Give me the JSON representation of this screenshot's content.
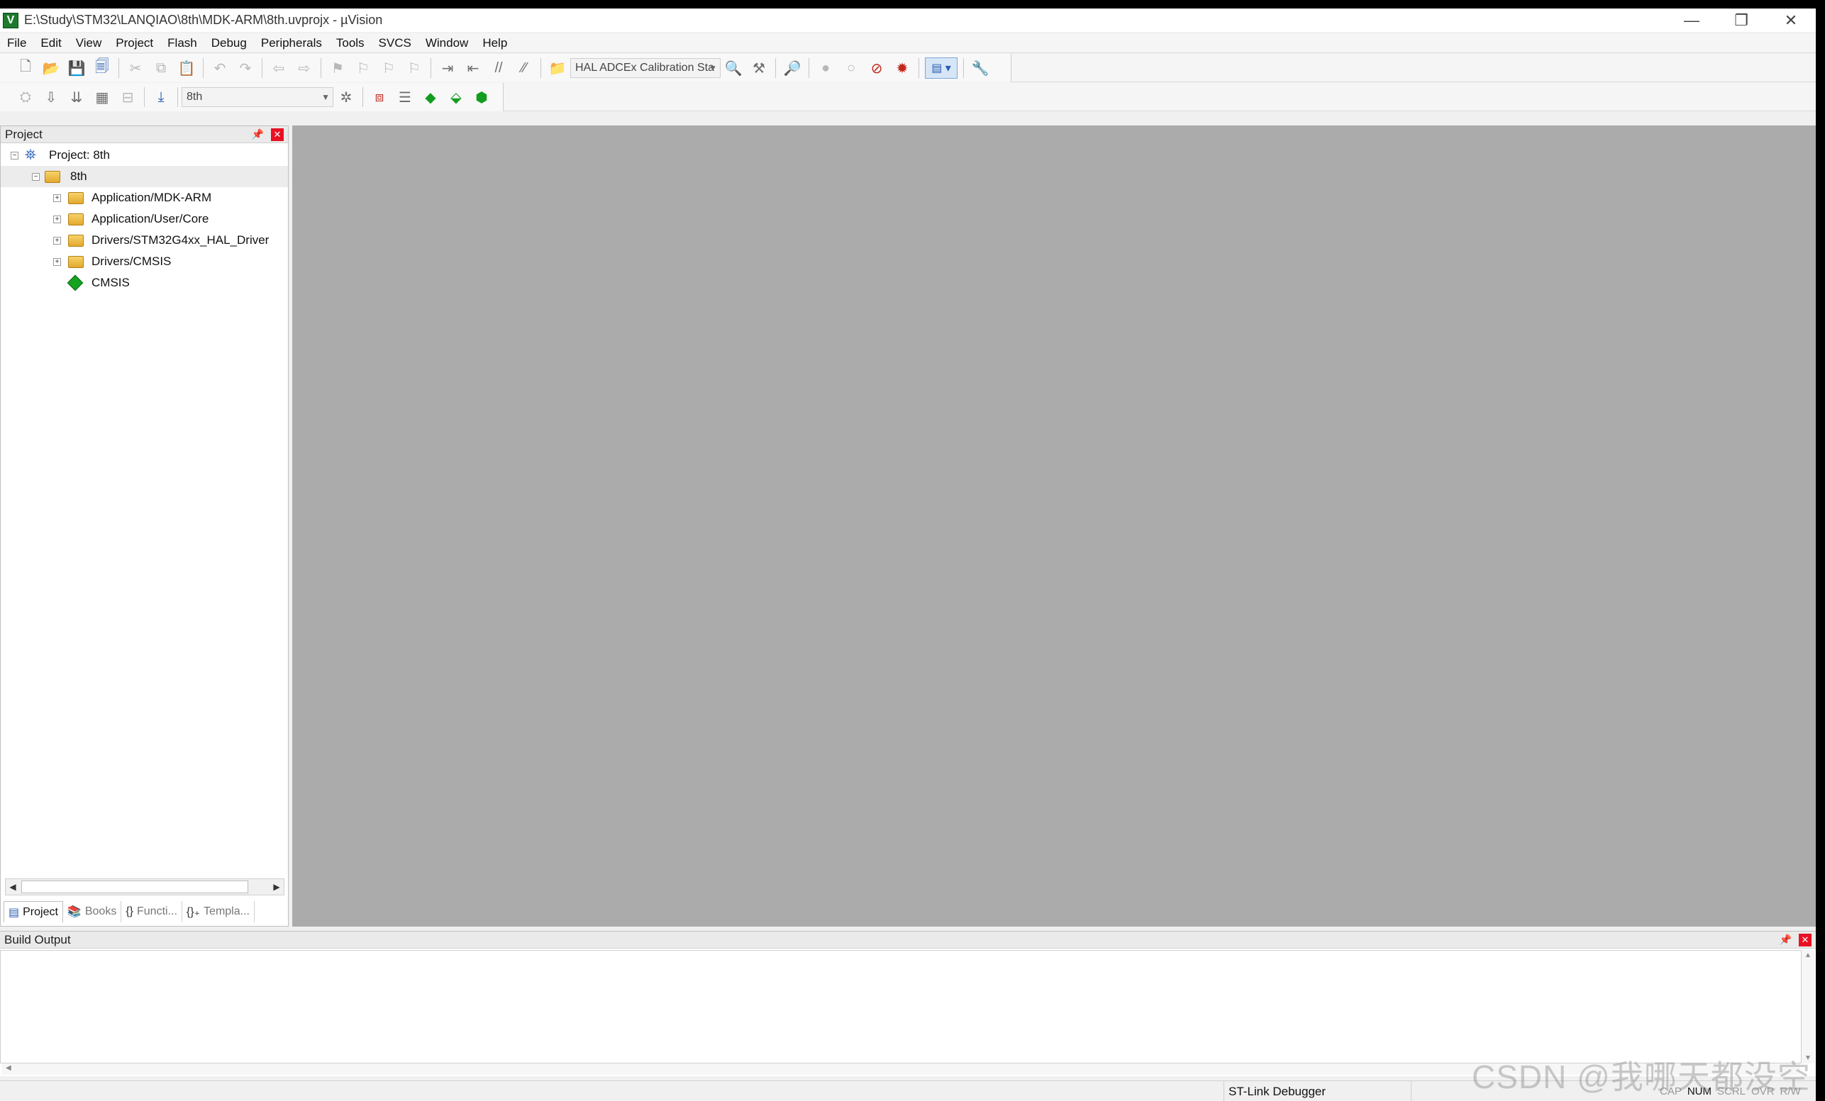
{
  "window": {
    "title": "E:\\Study\\STM32\\LANQIAO\\8th\\MDK-ARM\\8th.uvprojx - µVision",
    "app_icon_letter": "V",
    "controls": {
      "minimize": "—",
      "restore": "❐",
      "close": "✕"
    }
  },
  "menu": [
    "File",
    "Edit",
    "View",
    "Project",
    "Flash",
    "Debug",
    "Peripherals",
    "Tools",
    "SVCS",
    "Window",
    "Help"
  ],
  "toolbar1": {
    "find_combo": "HAL ADCEx Calibration Sta"
  },
  "toolbar2": {
    "target_combo": "8th"
  },
  "project_panel": {
    "title": "Project",
    "tree": {
      "root": "Project: 8th",
      "target": "8th",
      "groups": [
        "Application/MDK-ARM",
        "Application/User/Core",
        "Drivers/STM32G4xx_HAL_Driver",
        "Drivers/CMSIS"
      ],
      "component": "CMSIS"
    },
    "tabs": [
      "Project",
      "Books",
      "Functi...",
      "Templa..."
    ]
  },
  "build_output": {
    "title": "Build Output"
  },
  "statusbar": {
    "debugger": "ST-Link Debugger",
    "keys": [
      "CAP",
      "NUM",
      "SCRL",
      "OVR",
      "R/W"
    ]
  },
  "watermark": "CSDN @我哪天都没空"
}
